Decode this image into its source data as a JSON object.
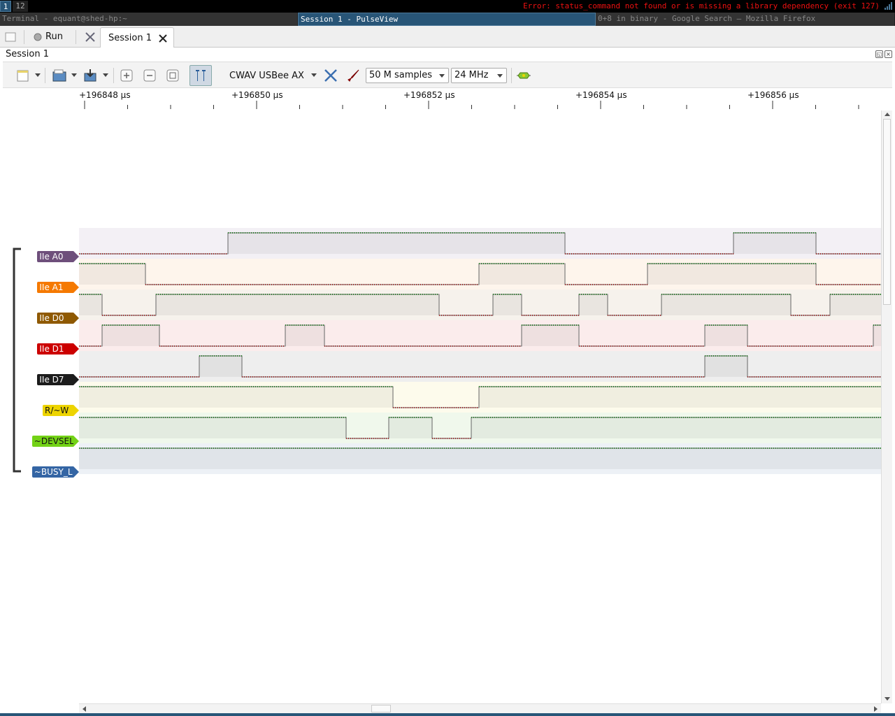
{
  "wm": {
    "workspaces": [
      "1",
      "12"
    ],
    "status_error": "Error: status_command not found or is missing a library dependency (exit 127)",
    "windows": [
      "Terminal - equant@shed-hp:~",
      "Session 1 - PulseView",
      "0+8 in binary - Google Search — Mozilla Firefox"
    ]
  },
  "app": {
    "run_label": "Run",
    "session_tab_label": "Session 1",
    "session_header": "Session 1"
  },
  "toolbar": {
    "device": "CWAV USBee AX",
    "samples": "50 M samples",
    "samplerate": "24 MHz"
  },
  "ruler": {
    "labels": [
      "+196848 µs",
      "+196850 µs",
      "+196852 µs",
      "+196854 µs",
      "+196856 µs"
    ]
  },
  "channels": [
    {
      "name": "IIe A0",
      "color": "#6e4f7b",
      "bg": "#f3f0f5"
    },
    {
      "name": "IIe A1",
      "color": "#f57900",
      "bg": "#fef5ec"
    },
    {
      "name": "IIe D0",
      "color": "#8f5902",
      "bg": "#f6f2ec"
    },
    {
      "name": "IIe D1",
      "color": "#cc0000",
      "bg": "#fbecec"
    },
    {
      "name": "IIe D7",
      "color": "#1c1c1c",
      "bg": "#eeeeee"
    },
    {
      "name": "R/~W",
      "color": "#edd400",
      "bg": "#fdfbec",
      "dark": true
    },
    {
      "name": "~DEVSEL",
      "color": "#73d216",
      "bg": "#f0f8ec",
      "dark": true
    },
    {
      "name": "~BUSY_L",
      "color": "#3465a4",
      "bg": "#edf1f6"
    }
  ]
}
